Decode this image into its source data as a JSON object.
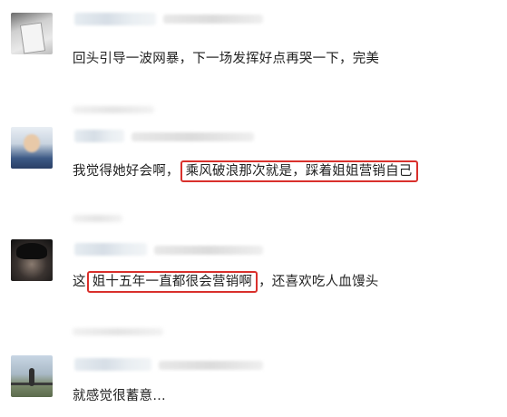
{
  "comments": [
    {
      "text": "回头引导一波网暴，下一场发挥好点再哭一下，完美"
    },
    {
      "text_before": "我觉得她好会啊，",
      "highlight": "乘风破浪那次就是，踩着姐姐营销自己",
      "text_after": ""
    },
    {
      "text_before": "这",
      "highlight": "姐十五年一直都很会营销啊",
      "text_after": "，还喜欢吃人血馒头"
    },
    {
      "text": "就感觉很蓄意…"
    }
  ],
  "colors": {
    "highlight_border": "#d9302c",
    "text": "#222222",
    "background": "#ffffff"
  }
}
